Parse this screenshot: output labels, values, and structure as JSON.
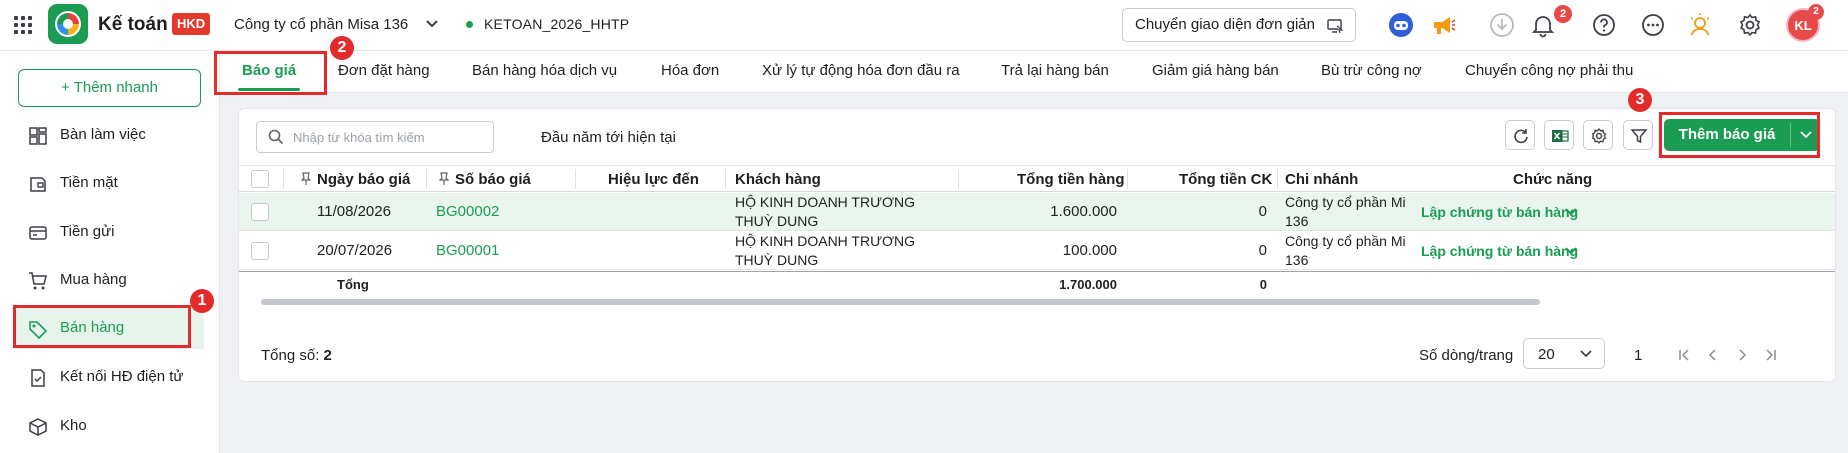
{
  "topbar": {
    "app_name": "Kế toán",
    "badge": "HKD",
    "company": "Công ty cổ phần Misa 136",
    "database": "KETOAN_2026_HHTP",
    "simple_ui_button": "Chuyển giao diện đơn giản",
    "notifications_count": "2",
    "avatar_initials": "KL",
    "avatar_badge": "2"
  },
  "sidebar": {
    "quick_add": "+ Thêm nhanh",
    "items": [
      {
        "label": "Bàn làm việc",
        "icon": "dashboard-icon"
      },
      {
        "label": "Tiền mặt",
        "icon": "cash-icon"
      },
      {
        "label": "Tiền gửi",
        "icon": "bank-icon"
      },
      {
        "label": "Mua hàng",
        "icon": "cart-icon"
      },
      {
        "label": "Bán hàng",
        "icon": "tag-icon",
        "active": true
      },
      {
        "label": "Kết nối HĐ điện tử",
        "icon": "einvoice-icon"
      },
      {
        "label": "Kho",
        "icon": "box-icon"
      }
    ]
  },
  "tabs": [
    "Báo giá",
    "Đơn đặt hàng",
    "Bán hàng hóa dịch vụ",
    "Hóa đơn",
    "Xử lý tự động hóa đơn đầu ra",
    "Trả lại hàng bán",
    "Giảm giá hàng bán",
    "Bù trừ công nợ",
    "Chuyển công nợ phải thu"
  ],
  "toolbar": {
    "search_placeholder": "Nhập từ khóa tìm kiếm",
    "period": "Đầu năm tới hiện tại",
    "add_button": "Thêm báo giá"
  },
  "table": {
    "headers": [
      "Ngày báo giá",
      "Số báo giá",
      "Hiệu lực đến",
      "Khách hàng",
      "Tổng tiền hàng",
      "Tổng tiền CK",
      "Chi nhánh",
      "Chức năng"
    ],
    "rows": [
      {
        "date": "11/08/2026",
        "number": "BG00002",
        "valid_to": "",
        "customer": "HỘ KINH DOANH TRƯƠNG THUỲ DUNG",
        "total": "1.600.000",
        "discount": "0",
        "branch": "Công ty cổ phần Mi 136",
        "action": "Lập chứng từ bán hàng"
      },
      {
        "date": "20/07/2026",
        "number": "BG00001",
        "valid_to": "",
        "customer": "HỘ KINH DOANH TRƯƠNG THUỲ DUNG",
        "total": "100.000",
        "discount": "0",
        "branch": "Công ty cổ phần Mi 136",
        "action": "Lập chứng từ bán hàng"
      }
    ],
    "total_label": "Tổng",
    "total_amount": "1.700.000",
    "total_discount": "0"
  },
  "footer": {
    "count_label": "Tổng số:",
    "count": "2",
    "rows_per_page_label": "Số dòng/trang",
    "rows_per_page": "20",
    "page": "1"
  },
  "annotations": [
    "1",
    "2",
    "3"
  ],
  "colors": {
    "accent": "#1a9c53",
    "highlight": "#e32b2b"
  }
}
